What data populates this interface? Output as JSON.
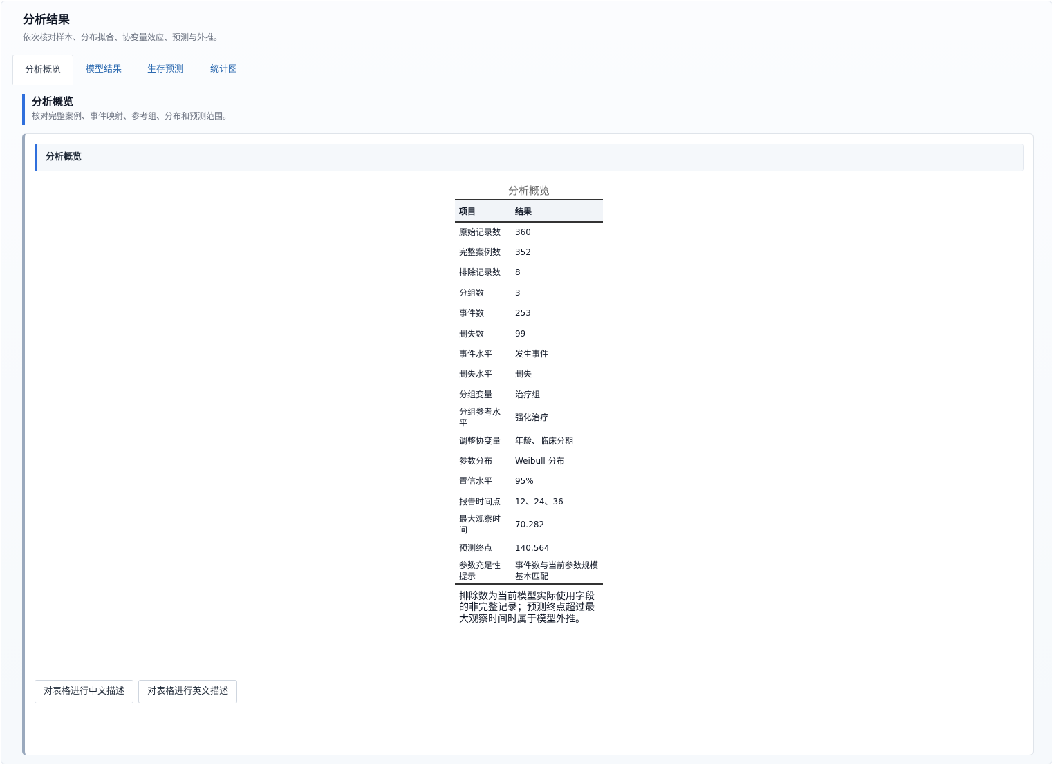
{
  "header": {
    "title": "分析结果",
    "subtitle": "依次核对样本、分布拟合、协变量效应、预测与外推。"
  },
  "tabs": [
    {
      "label": "分析概览",
      "active": true
    },
    {
      "label": "模型结果",
      "active": false
    },
    {
      "label": "生存预测",
      "active": false
    },
    {
      "label": "统计图",
      "active": false
    }
  ],
  "section": {
    "title": "分析概览",
    "subtitle": "核对完整案例、事件映射、参考组、分布和预测范围。"
  },
  "card": {
    "title": "分析概览"
  },
  "table": {
    "caption": "分析概览",
    "headers": [
      "项目",
      "结果"
    ],
    "rows": [
      [
        "原始记录数",
        "360"
      ],
      [
        "完整案例数",
        "352"
      ],
      [
        "排除记录数",
        "8"
      ],
      [
        "分组数",
        "3"
      ],
      [
        "事件数",
        "253"
      ],
      [
        "删失数",
        "99"
      ],
      [
        "事件水平",
        "发生事件"
      ],
      [
        "删失水平",
        "删失"
      ],
      [
        "分组变量",
        "治疗组"
      ],
      [
        "分组参考水平",
        "强化治疗"
      ],
      [
        "调整协变量",
        "年龄、临床分期"
      ],
      [
        "参数分布",
        "Weibull 分布"
      ],
      [
        "置信水平",
        "95%"
      ],
      [
        "报告时间点",
        "12、24、36"
      ],
      [
        "最大观察时间",
        "70.282"
      ],
      [
        "预测终点",
        "140.564"
      ],
      [
        "参数充足性提示",
        "事件数与当前参数规模基本匹配"
      ]
    ],
    "note": "排除数为当前模型实际使用字段的非完整记录；预测终点超过最大观察时间时属于模型外推。"
  },
  "buttons": {
    "describe_cn": "对表格进行中文描述",
    "describe_en": "对表格进行英文描述"
  },
  "colors": {
    "accent": "#2f6fdc",
    "tab_link": "#2d6bb1",
    "card_border": "#9aa9bd"
  }
}
